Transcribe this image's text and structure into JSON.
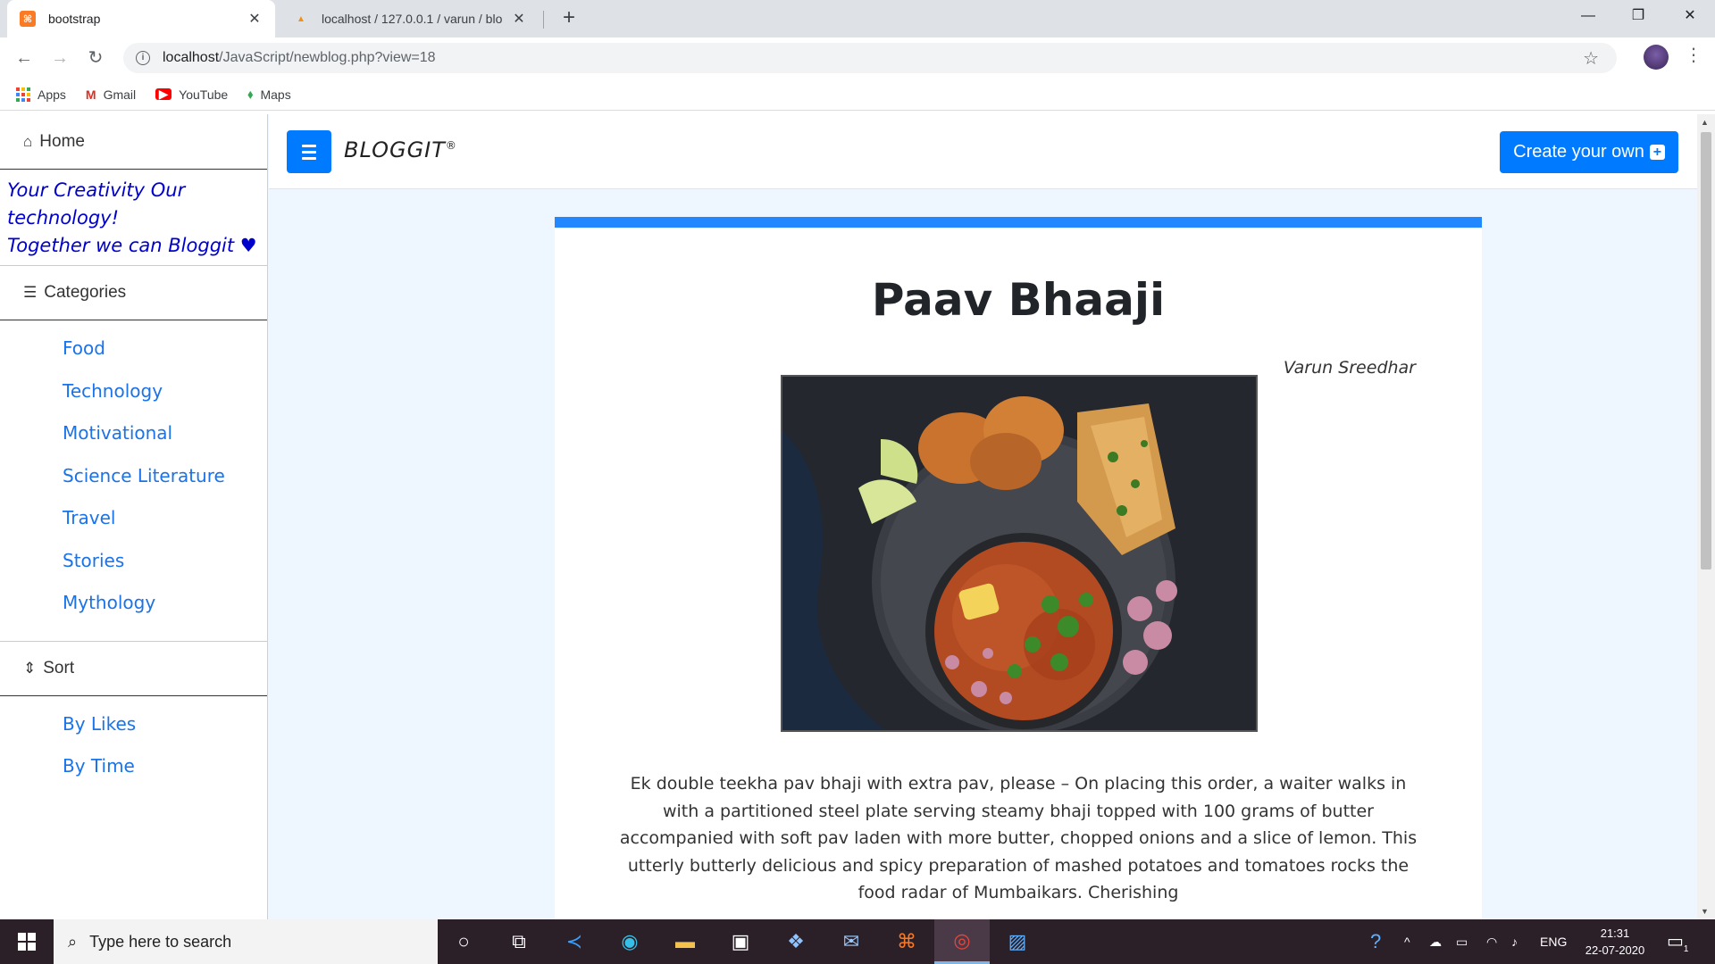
{
  "browser": {
    "tabs": [
      {
        "title": "bootstrap",
        "active": true
      },
      {
        "title": "localhost / 127.0.0.1 / varun / blo",
        "active": false
      }
    ],
    "new_tab": "+",
    "url_host": "localhost",
    "url_path": "/JavaScript/newblog.php?view=18",
    "bookmarks": [
      {
        "label": "Apps",
        "icon": "apps-icon"
      },
      {
        "label": "Gmail",
        "icon": "gmail-icon"
      },
      {
        "label": "YouTube",
        "icon": "youtube-icon"
      },
      {
        "label": "Maps",
        "icon": "maps-icon"
      }
    ]
  },
  "sidebar": {
    "home_label": "Home",
    "tagline_line1": "Your Creativity Our technology!",
    "tagline_line2": "Together we can Bloggit",
    "categories_label": "Categories",
    "categories": [
      "Food",
      "Technology",
      "Motivational",
      "Science Literature",
      "Travel",
      "Stories",
      "Mythology"
    ],
    "sort_label": "Sort",
    "sort_options": [
      "By Likes",
      "By Time"
    ]
  },
  "topbar": {
    "brand": "BLOGGIT",
    "brand_mark": "®",
    "create_button": "Create your own"
  },
  "post": {
    "title": "Paav Bhaaji",
    "author": "Varun Sreedhar",
    "body": "Ek double teekha pav bhaji with extra pav, please – On placing this order, a waiter walks in with a partitioned steel plate serving steamy bhaji topped with 100 grams of butter accompanied with soft pav laden with more butter, chopped onions and a slice of lemon. This utterly butterly delicious and spicy preparation of mashed potatoes and tomatoes rocks the food radar of Mumbaikars. Cherishing"
  },
  "taskbar": {
    "search_placeholder": "Type here to search",
    "language": "ENG",
    "time": "21:31",
    "date": "22-07-2020",
    "notification_count": "1"
  },
  "colors": {
    "primary": "#007bff",
    "accent_bar": "#2188ff",
    "tagline": "#0000cc",
    "link": "#1a73e8",
    "page_bg": "#eef6ff"
  }
}
